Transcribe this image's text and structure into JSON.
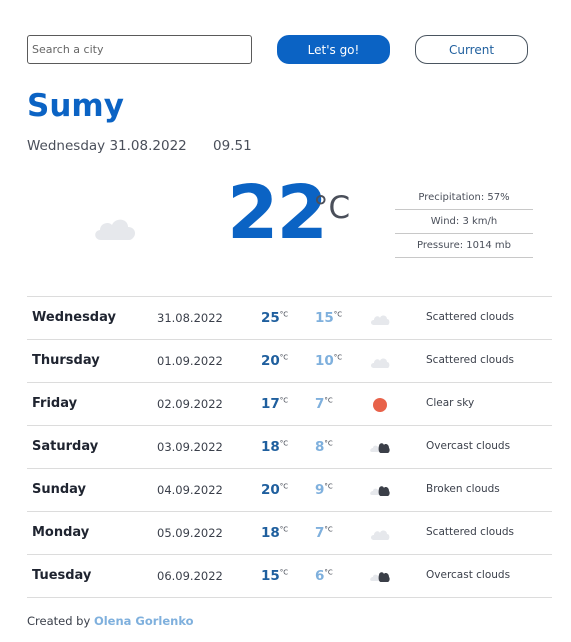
{
  "search": {
    "placeholder": "Search a city",
    "go_label": "Let's go!",
    "current_label": "Current"
  },
  "city": "Sumy",
  "date_label": "Wednesday 31.08.2022",
  "time_label": "09.51",
  "current": {
    "temperature": "22",
    "unit": "°C",
    "icon": "cloud-icon",
    "precipitation": "Precipitation: 57%",
    "wind": "Wind: 3 km/h",
    "pressure": "Pressure: 1014 mb"
  },
  "forecast": [
    {
      "day": "Wednesday",
      "date": "31.08.2022",
      "max": "25",
      "min": "15",
      "unit": "°C",
      "icon": "cloud-icon",
      "desc": "Scattered clouds"
    },
    {
      "day": "Thursday",
      "date": "01.09.2022",
      "max": "20",
      "min": "10",
      "unit": "°C",
      "icon": "cloud-icon",
      "desc": "Scattered clouds"
    },
    {
      "day": "Friday",
      "date": "02.09.2022",
      "max": "17",
      "min": "7",
      "unit": "°C",
      "icon": "sun-icon",
      "desc": "Clear sky"
    },
    {
      "day": "Saturday",
      "date": "03.09.2022",
      "max": "18",
      "min": "8",
      "unit": "°C",
      "icon": "overcast-cloud-icon",
      "desc": "Overcast clouds"
    },
    {
      "day": "Sunday",
      "date": "04.09.2022",
      "max": "20",
      "min": "9",
      "unit": "°C",
      "icon": "broken-cloud-icon",
      "desc": "Broken clouds"
    },
    {
      "day": "Monday",
      "date": "05.09.2022",
      "max": "18",
      "min": "7",
      "unit": "°C",
      "icon": "cloud-icon",
      "desc": "Scattered clouds"
    },
    {
      "day": "Tuesday",
      "date": "06.09.2022",
      "max": "15",
      "min": "6",
      "unit": "°C",
      "icon": "overcast-cloud-icon",
      "desc": "Overcast clouds"
    }
  ],
  "footer": {
    "prefix": "Created by",
    "author": "Olena Gorlenko"
  },
  "colors": {
    "primary": "#0b63c4",
    "light_blue": "#7fb0dd",
    "sun": "#e8624a"
  }
}
